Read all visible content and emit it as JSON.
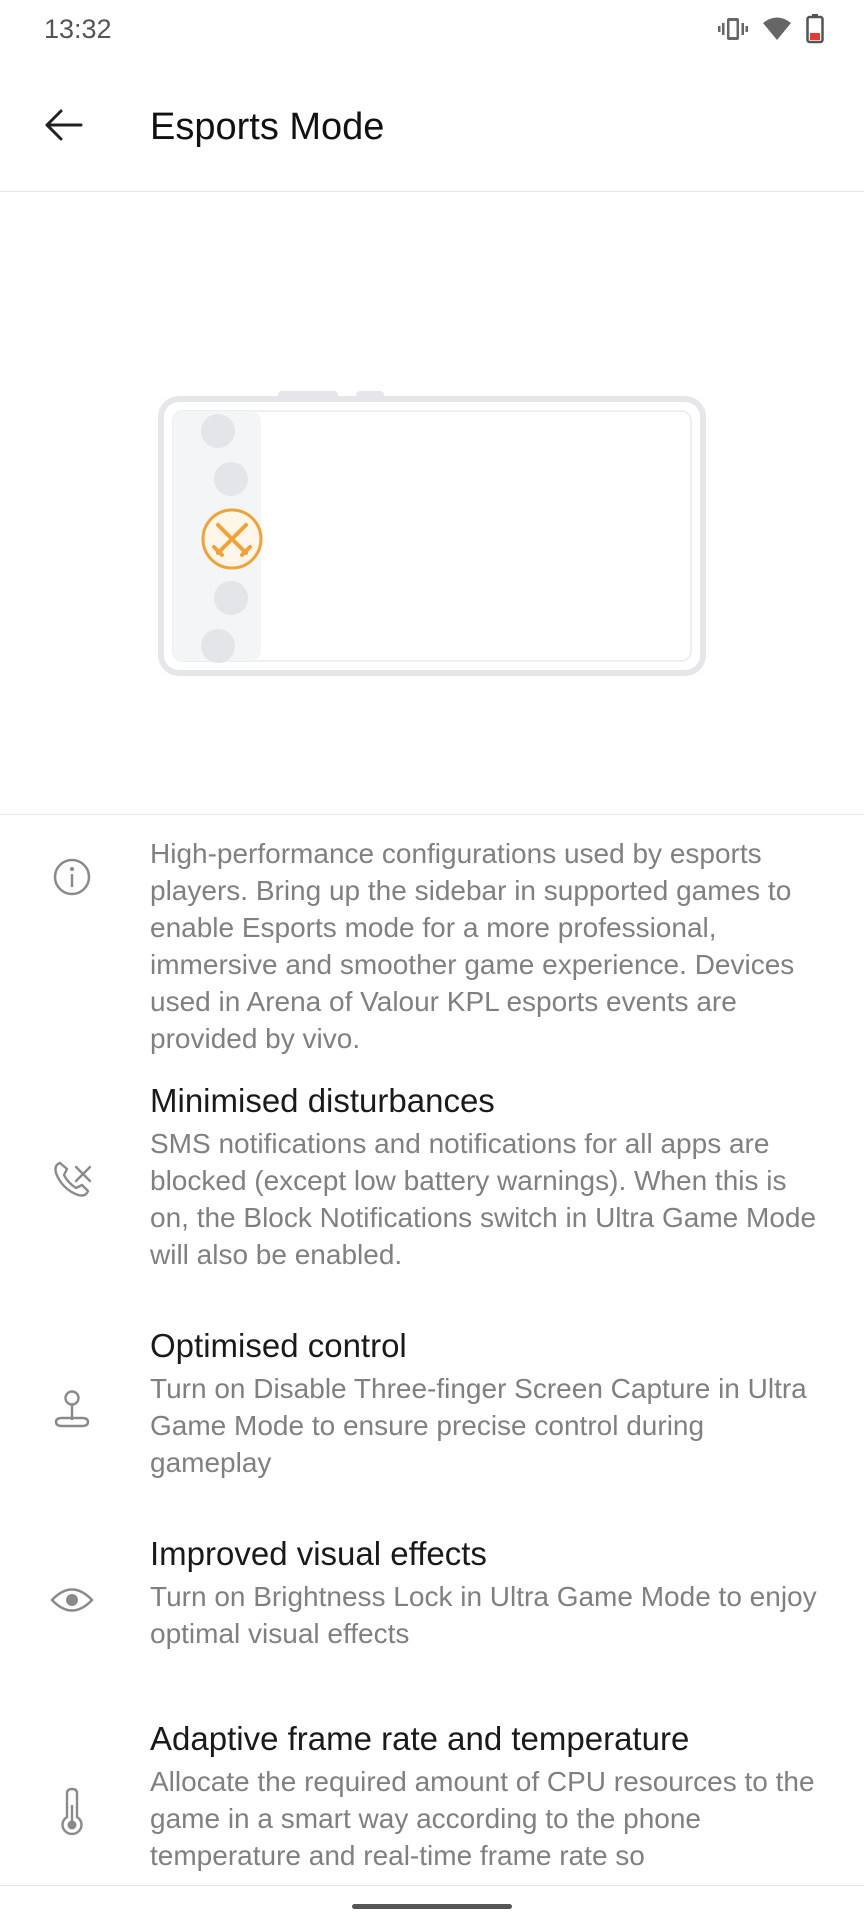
{
  "status_bar": {
    "time": "13:32",
    "icons": [
      "vibrate-icon",
      "wifi-icon",
      "battery-icon"
    ]
  },
  "app_bar": {
    "back_icon": "back-arrow-icon",
    "title": "Esports Mode"
  },
  "hero": {
    "illustration": "phone-landscape-with-sidebar-esports-icon",
    "accent_color": "#f0a23a"
  },
  "info": {
    "icon": "info-icon",
    "text": "High-performance configurations used by esports players. Bring up the sidebar in supported games to enable Esports mode for a more professional, immersive and smoother game experience. Devices used in Arena of Valour KPL esports events are provided by vivo."
  },
  "features": [
    {
      "icon": "phone-muted-icon",
      "title": "Minimised disturbances",
      "description": "SMS notifications and notifications for all apps are blocked (except low battery warnings). When this is on, the Block Notifications switch in Ultra Game Mode will also be enabled."
    },
    {
      "icon": "joystick-icon",
      "title": "Optimised control",
      "description": "Turn on Disable Three-finger Screen Capture in Ultra Game Mode to ensure precise control during gameplay"
    },
    {
      "icon": "eye-icon",
      "title": "Improved visual effects",
      "description": "Turn on Brightness Lock in Ultra Game Mode to enjoy optimal visual effects"
    },
    {
      "icon": "thermometer-icon",
      "title": "Adaptive frame rate and temperature",
      "description": "Allocate the required amount of CPU resources to the game in a smart way according to the phone temperature and real-time frame rate so"
    }
  ]
}
